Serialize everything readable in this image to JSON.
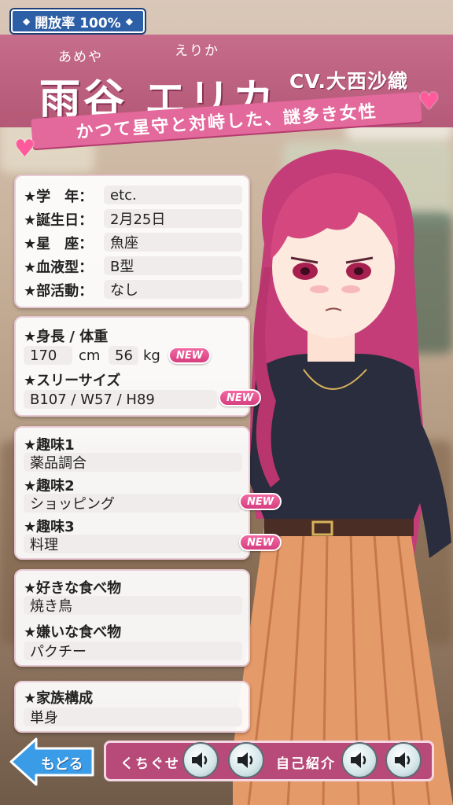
{
  "header": {
    "open_rate": "開放率 100%",
    "ruby_family": "あめや",
    "ruby_given": "えりか",
    "name": "雨谷 エリカ",
    "cv": "CV.大西沙織",
    "subtitle": "かつて星守と対峙した、謎多き女性"
  },
  "basic": {
    "grade_label": "★学　年：",
    "grade_value": "etc.",
    "birthday_label": "★誕生日：",
    "birthday_value": "2月25日",
    "sign_label": "★星　座：",
    "sign_value": "魚座",
    "blood_label": "★血液型：",
    "blood_value": "B型",
    "club_label": "★部活動：",
    "club_value": "なし"
  },
  "body": {
    "hw_label": "★身長 / 体重",
    "height_value": "170",
    "height_unit": "cm",
    "weight_value": "56",
    "weight_unit": "kg",
    "sizes_label": "★スリーサイズ",
    "sizes_value": "B107 / W57 / H89",
    "new_label": "NEW"
  },
  "hobbies": {
    "hobby1_label": "★趣味1",
    "hobby1_value": "薬品調合",
    "hobby2_label": "★趣味2",
    "hobby2_value": "ショッピング",
    "hobby3_label": "★趣味3",
    "hobby3_value": "料理",
    "new_label": "NEW"
  },
  "food": {
    "like_label": "★好きな食べ物",
    "like_value": "焼き鳥",
    "dislike_label": "★嫌いな食べ物",
    "dislike_value": "パクチー"
  },
  "family": {
    "label": "★家族構成",
    "value": "単身"
  },
  "footer": {
    "back_label": "もどる",
    "catchphrase_label": "くちぐせ",
    "intro_label": "自己紹介"
  },
  "icons": {
    "badge_deco": "diamond-icon",
    "heart": "heart-icon",
    "speaker": "speaker-icon",
    "back": "back-arrow-icon"
  },
  "colors": {
    "banner": "#c0628a",
    "new_badge": "#e0508f",
    "open_badge": "#2d5fa7",
    "voice_bar": "#b84a7a"
  }
}
